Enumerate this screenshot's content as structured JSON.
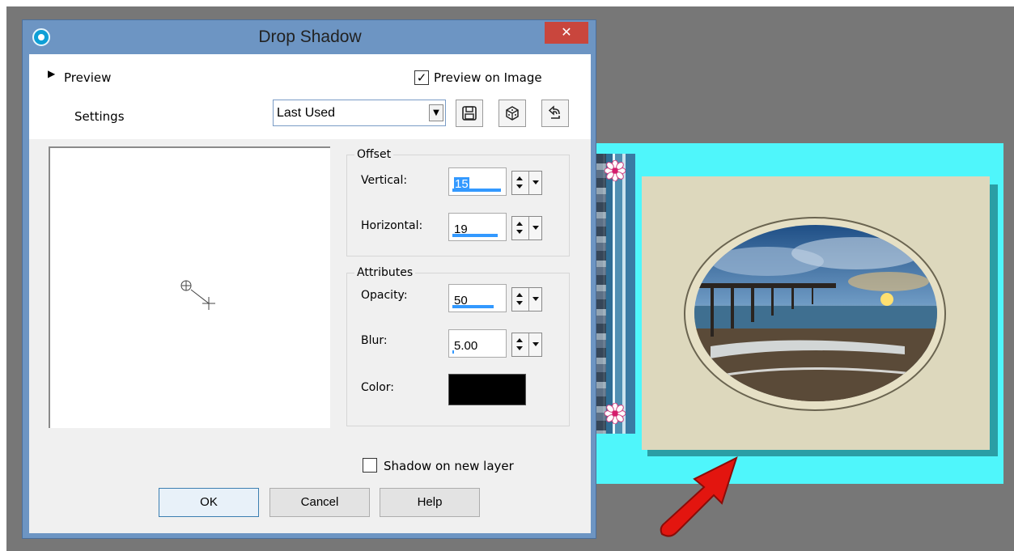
{
  "dialog": {
    "title": "Drop Shadow",
    "close_glyph": "✕"
  },
  "preview": {
    "label": "Preview",
    "toggle_glyph": "▶",
    "on_image_label": "Preview on Image",
    "on_image_checked": true,
    "check_glyph": "✓"
  },
  "settings": {
    "label": "Settings",
    "selected": "Last Used",
    "dropdown_glyph": "▼",
    "tool_icons": [
      "save-icon",
      "randomize-icon",
      "reset-icon"
    ]
  },
  "offset": {
    "title": "Offset",
    "vertical_label": "Vertical:",
    "vertical_value": "15",
    "vertical_fill": 0.85,
    "horizontal_label": "Horizontal:",
    "horizontal_value": "19",
    "horizontal_fill": 0.8
  },
  "attributes": {
    "title": "Attributes",
    "opacity_label": "Opacity:",
    "opacity_value": "50",
    "opacity_fill": 0.73,
    "blur_label": "Blur:",
    "blur_value": "5.00",
    "blur_fill": 0.03,
    "color_label": "Color:",
    "color_value": "#000000"
  },
  "shadow_on_new_layer": {
    "label": "Shadow on new layer",
    "checked": false
  },
  "buttons": {
    "ok": "OK",
    "cancel": "Cancel",
    "help": "Help"
  },
  "colors": {
    "title_bar": "#6d95c3",
    "close_button": "#c9463d",
    "canvas_background": "#4ff6fb",
    "card_background": "#ddd8bd",
    "card_shadow": "#2a9ea5",
    "arrow": "#e3150f",
    "workspace": "#777777"
  }
}
